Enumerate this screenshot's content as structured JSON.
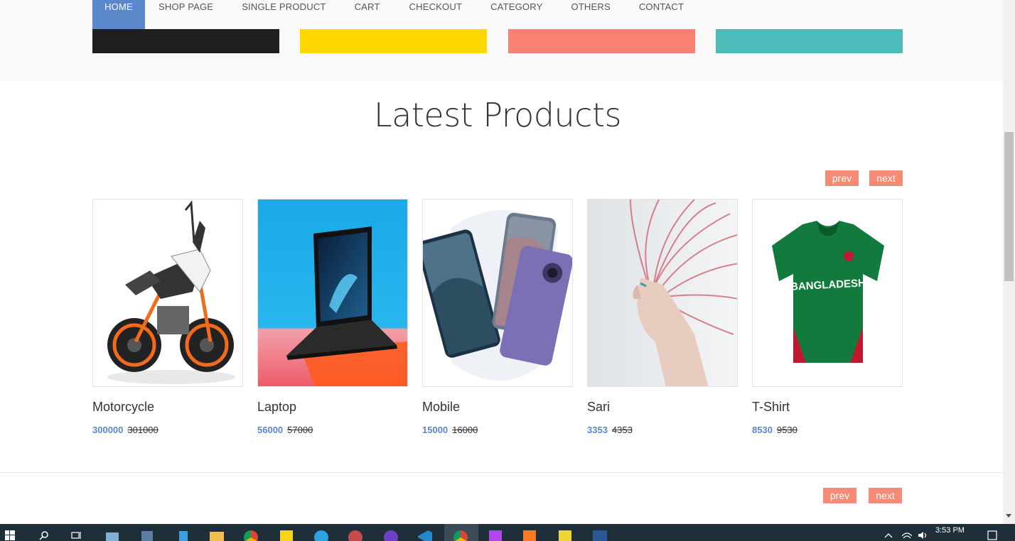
{
  "nav": {
    "items": [
      {
        "label": "HOME",
        "active": true
      },
      {
        "label": "SHOP PAGE"
      },
      {
        "label": "SINGLE PRODUCT"
      },
      {
        "label": "CART"
      },
      {
        "label": "CHECKOUT"
      },
      {
        "label": "CATEGORY"
      },
      {
        "label": "OTHERS"
      },
      {
        "label": "CONTACT"
      }
    ]
  },
  "color_blocks": [
    "#1f1f1f",
    "#ffd800",
    "#f98172",
    "#4ebbbb"
  ],
  "section": {
    "title": "Latest Products"
  },
  "pager": {
    "prev": "prev",
    "next": "next"
  },
  "products": [
    {
      "name": "Motorcycle",
      "price": "300000",
      "old_price": "301000",
      "image": "motorcycle-image"
    },
    {
      "name": "Laptop",
      "price": "56000",
      "old_price": "57000",
      "image": "laptop-image"
    },
    {
      "name": "Mobile",
      "price": "15000",
      "old_price": "16000",
      "image": "mobile-image"
    },
    {
      "name": "Sari",
      "price": "3353",
      "old_price": "4353",
      "image": "sari-image"
    },
    {
      "name": "T-Shirt",
      "price": "8530",
      "old_price": "9530",
      "image": "tshirt-image"
    }
  ],
  "colors": {
    "accent": "#5a88ca",
    "pager": "#f58b76"
  },
  "taskbar": {
    "time": "3:53 PM"
  }
}
